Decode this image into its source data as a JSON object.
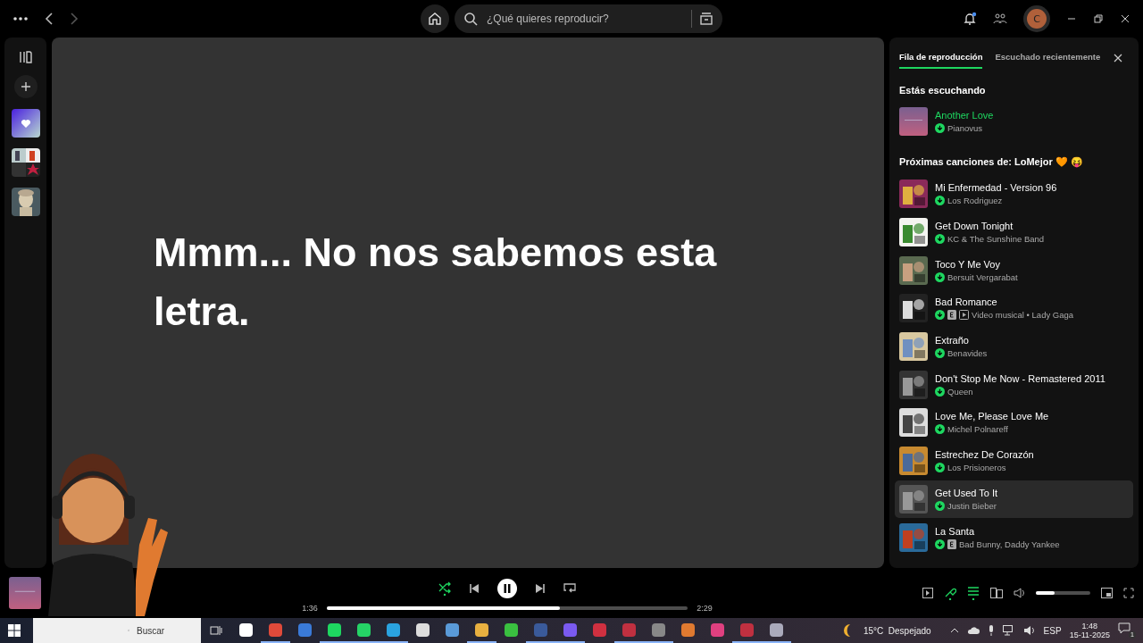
{
  "topbar": {
    "search": {
      "placeholder": "¿Qué quieres reproducir?"
    },
    "notifications": {
      "unread": true
    },
    "avatar": {
      "initial": "C"
    }
  },
  "lyrics": {
    "message": "Mmm... No nos sabemos esta letra."
  },
  "queue_panel": {
    "tabs": [
      {
        "label": "Fila de reproducción",
        "selected": true
      },
      {
        "label": "Escuchado recientemente",
        "selected": false
      }
    ],
    "now_playing_heading": "Estás escuchando",
    "now_playing": {
      "title": "Another Love",
      "artist": "Pianovus",
      "downloaded": true
    },
    "next_heading": "Próximas canciones de: LoMejor 🧡 😝",
    "tracks": [
      {
        "title": "Mi Enfermedad - Version 96",
        "artist": "Los Rodriguez",
        "downloaded": true,
        "explicit": false,
        "video": false,
        "selected": false
      },
      {
        "title": "Get Down Tonight",
        "artist": "KC & The Sunshine Band",
        "downloaded": true,
        "explicit": false,
        "video": false,
        "selected": false
      },
      {
        "title": "Toco Y Me Voy",
        "artist": "Bersuit Vergarabat",
        "downloaded": true,
        "explicit": false,
        "video": false,
        "selected": false
      },
      {
        "title": "Bad Romance",
        "artist": "Video musical • Lady Gaga",
        "downloaded": true,
        "explicit": true,
        "video": true,
        "selected": false
      },
      {
        "title": "Extraño",
        "artist": "Benavides",
        "downloaded": true,
        "explicit": false,
        "video": false,
        "selected": false
      },
      {
        "title": "Don't Stop Me Now - Remastered 2011",
        "artist": "Queen",
        "downloaded": true,
        "explicit": false,
        "video": false,
        "selected": false
      },
      {
        "title": "Love Me, Please Love Me",
        "artist": "Michel Polnareff",
        "downloaded": true,
        "explicit": false,
        "video": false,
        "selected": false
      },
      {
        "title": "Estrechez De Corazón",
        "artist": "Los Prisioneros",
        "downloaded": true,
        "explicit": false,
        "video": false,
        "selected": false
      },
      {
        "title": "Get Used To It",
        "artist": "Justin Bieber",
        "downloaded": true,
        "explicit": false,
        "video": false,
        "selected": true
      },
      {
        "title": "La Santa",
        "artist": "Bad Bunny, Daddy Yankee",
        "downloaded": true,
        "explicit": true,
        "video": false,
        "selected": false
      }
    ]
  },
  "player": {
    "shuffle": true,
    "playing": true,
    "repeat": false,
    "elapsed": "1:36",
    "duration": "2:29",
    "progress": {
      "level": 0.645
    },
    "lyrics_on": true,
    "queue_on": true,
    "volume": {
      "level": 0.35
    }
  },
  "taskbar": {
    "search": {
      "placeholder": "Buscar"
    },
    "apps": [
      {
        "running": false
      },
      {
        "running": true
      },
      {
        "running": false
      },
      {
        "running": true
      },
      {
        "running": true
      },
      {
        "running": true
      },
      {
        "running": false
      },
      {
        "running": false
      },
      {
        "running": true
      },
      {
        "running": false
      },
      {
        "running": true
      },
      {
        "running": true
      },
      {
        "running": false
      },
      {
        "running": true
      },
      {
        "running": true
      },
      {
        "running": false
      },
      {
        "running": false
      },
      {
        "running": true
      },
      {
        "running": true
      }
    ],
    "weather": "15°C  Despejado",
    "language": "ESP",
    "time": "1:48",
    "date": "15-11-2025",
    "notification_count": "1"
  }
}
